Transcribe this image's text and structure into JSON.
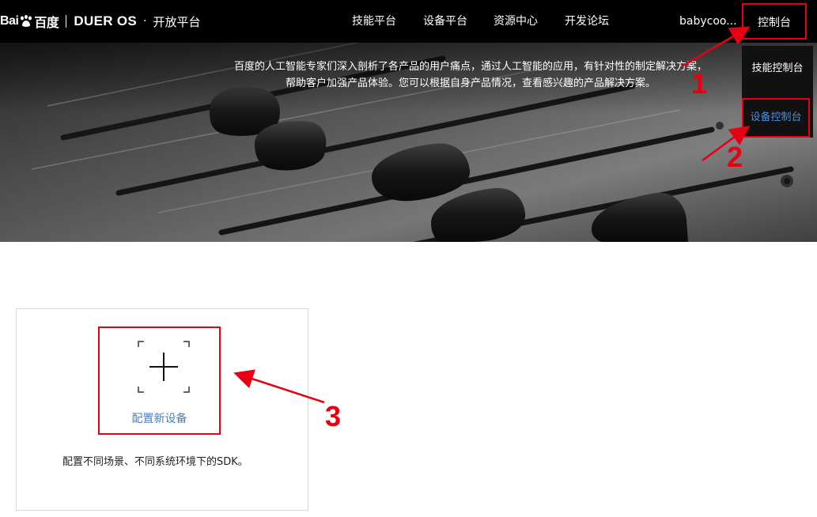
{
  "header": {
    "logo": {
      "baidu_left": "Bai",
      "baidu_right": "百度",
      "dueros": "DUER OS",
      "dot": "·",
      "platform": "开放平台"
    },
    "nav": [
      {
        "label": "技能平台"
      },
      {
        "label": "设备平台"
      },
      {
        "label": "资源中心"
      },
      {
        "label": "开发论坛"
      }
    ],
    "user": "babycoo...",
    "console_label": "控制台"
  },
  "dropdown": {
    "items": [
      {
        "label": "技能控制台"
      },
      {
        "label": "设备控制台"
      }
    ]
  },
  "hero": {
    "line1": "百度的人工智能专家们深入剖析了各产品的用户痛点，通过人工智能的应用，有针对性的制定解决方案，",
    "line2": "帮助客户加强产品体验。您可以根据自身产品情况，查看感兴趣的产品解决方案。"
  },
  "card": {
    "add_label": "配置新设备",
    "description": "配置不同场景、不同系统环境下的SDK。"
  },
  "annotations": {
    "n1": "1",
    "n2": "2",
    "n3": "3"
  },
  "colors": {
    "topbar": "#000000",
    "highlight_red": "#e60012",
    "link_blue": "#4a7fc1",
    "dropdown_bg": "#111111"
  },
  "icons": {
    "logo_paw": "paw-icon",
    "add_device": "plus-icon"
  }
}
